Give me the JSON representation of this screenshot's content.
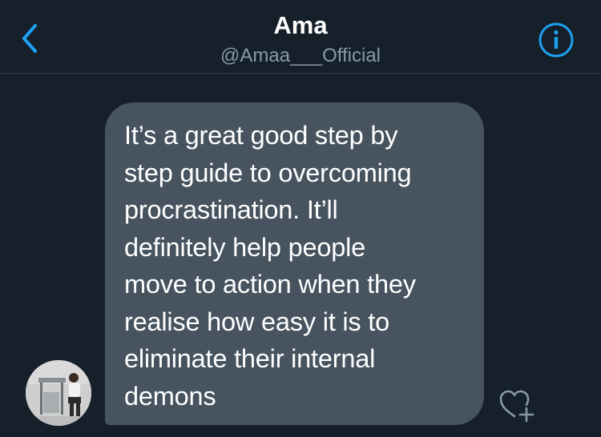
{
  "header": {
    "title": "Ama",
    "handle": "@Amaa___Official",
    "back_icon": "chevron-left-icon",
    "info_icon": "info-circle-icon"
  },
  "message": {
    "text": "It’s a great good step by\nstep guide to overcoming\nprocrastination. It’ll\ndefinitely help people\nmove to action when they\nrealise how easy it is to\neliminate their internal\ndemons",
    "like_icon": "heart-plus-icon"
  },
  "colors": {
    "background": "#15202b",
    "accent": "#1da1f2",
    "bubble": "#475460",
    "secondary_text": "#8899a6",
    "divider": "#38444d"
  }
}
